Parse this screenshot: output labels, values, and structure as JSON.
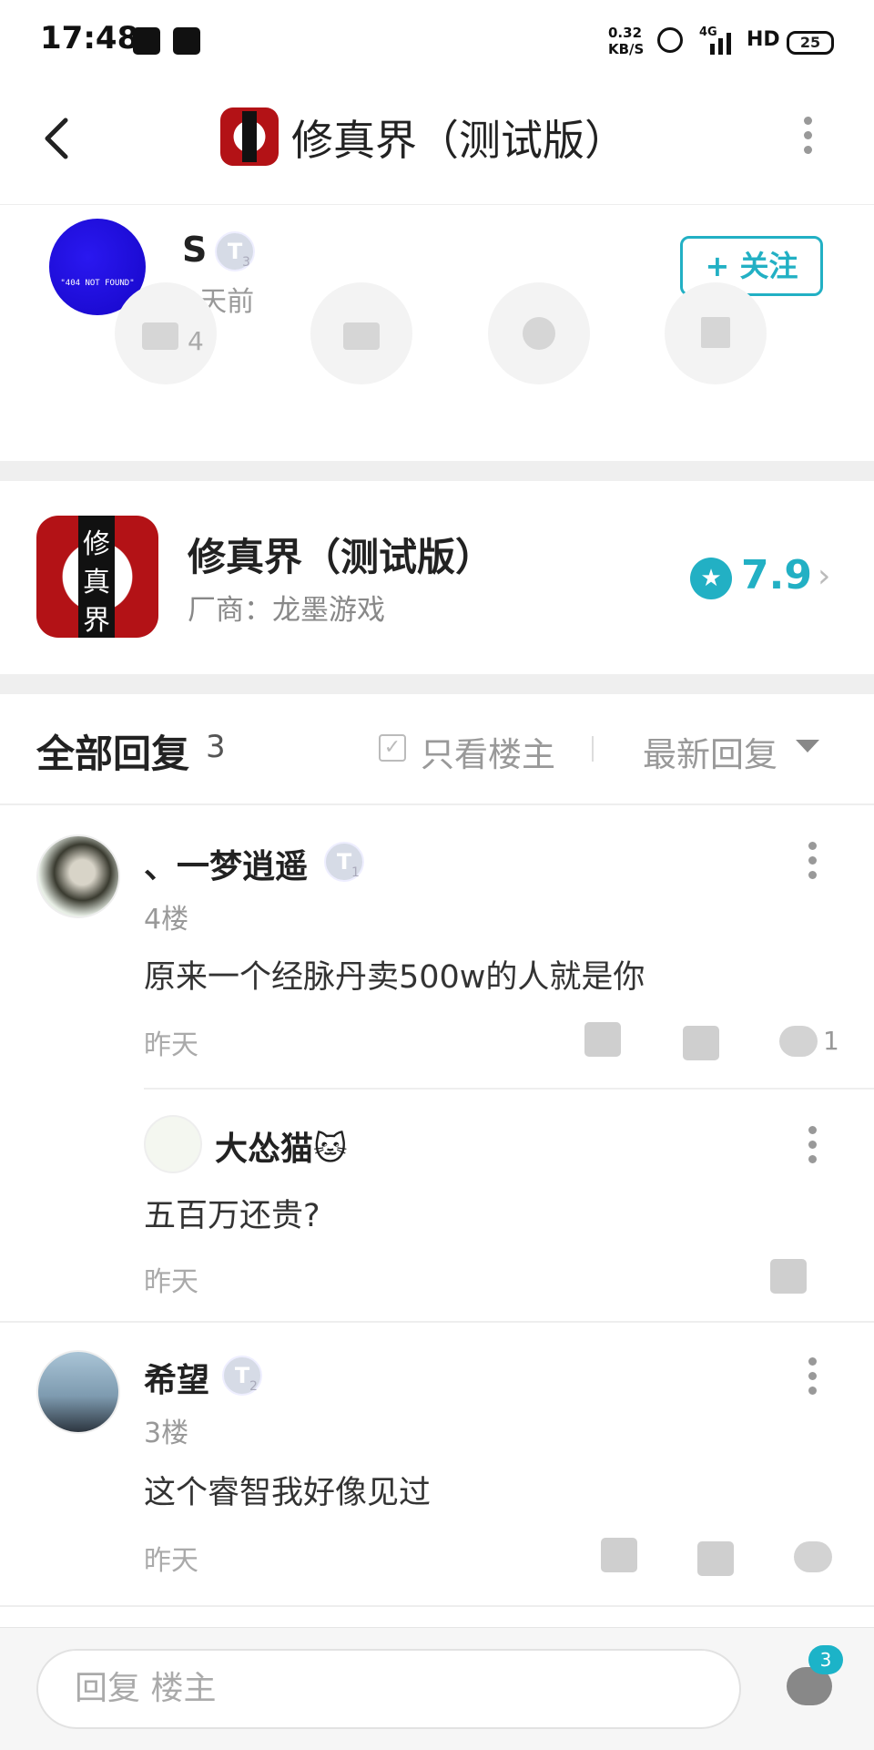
{
  "status_bar": {
    "time": "17:48",
    "net_speed_top": "0.32",
    "net_speed_bottom": "KB/S",
    "network": "4G",
    "hd": "HD",
    "battery": "25"
  },
  "header": {
    "title": "修真界（测试版）"
  },
  "author": {
    "name": "S",
    "level": "3",
    "time": "2天前",
    "follow_label": "+ 关注",
    "like_count": "4"
  },
  "game": {
    "name": "修真界（测试版）",
    "vendor": "厂商：龙墨游戏",
    "score": "7.9",
    "icon_chars": [
      "修",
      "真",
      "界"
    ]
  },
  "replies": {
    "title": "全部回复",
    "count": "3",
    "only_owner": "只看楼主",
    "sort": "最新回复"
  },
  "comments": [
    {
      "name": "、一梦逍遥",
      "level": "1",
      "floor": "4楼",
      "text": "原来一个经脉丹卖500w的人就是你",
      "time": "昨天",
      "reply_count": "1",
      "sub_reply": {
        "name": "大怂猫🐱",
        "text": "五百万还贵?",
        "time": "昨天"
      }
    },
    {
      "name": "希望",
      "level": "2",
      "floor": "3楼",
      "text": "这个睿智我好像见过",
      "time": "昨天"
    }
  ],
  "bottom_bar": {
    "placeholder": "回复  楼主",
    "message_badge": "3"
  },
  "colors": {
    "accent": "#22b0c4",
    "brand_red": "#b31216"
  }
}
